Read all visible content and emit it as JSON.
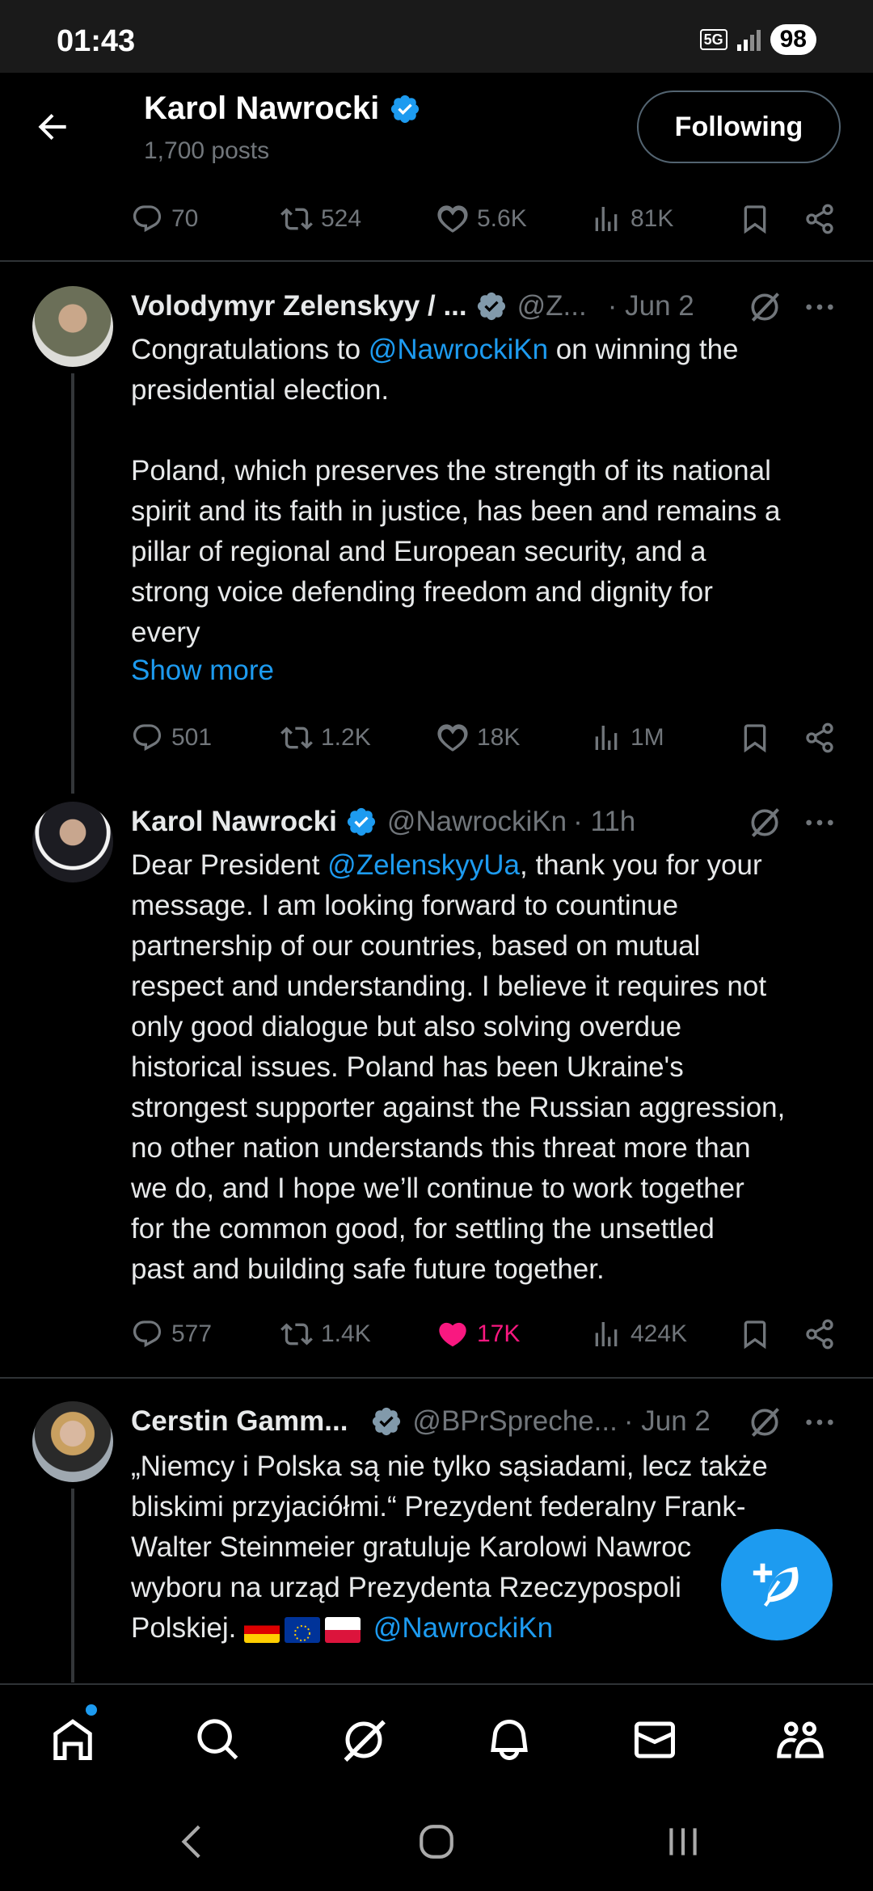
{
  "status_bar": {
    "time": "01:43",
    "network": "5G",
    "battery": "98"
  },
  "header": {
    "name": "Karol Nawrocki",
    "posts": "1,700 posts",
    "follow_label": "Following"
  },
  "top_actions": {
    "replies": "70",
    "retweets": "524",
    "likes": "5.6K",
    "views": "81K"
  },
  "tweets": [
    {
      "name": "Volodymyr Zelenskyy / ...",
      "handle": "@Z...",
      "time": "· Jun 2",
      "text_pre": "Congratulations to ",
      "mention": "@NawrockiKn",
      "text_post": " on winning the\npresidential election.\n\nPoland, which preserves the strength of its national\nspirit and its faith in justice, has been and remains a\npillar of regional and European security, and a\nstrong voice defending freedom and dignity for\nevery",
      "show_more": "Show more",
      "replies": "501",
      "retweets": "1.2K",
      "likes": "18K",
      "views": "1M"
    },
    {
      "name": "Karol Nawrocki",
      "handle": "@NawrockiKn",
      "time": "· 11h",
      "text_pre": "Dear President ",
      "mention": "@ZelenskyyUa",
      "text_post": ", thank you for your\nmessage. I am looking forward to countinue\npartnership of our countries, based on mutual\nrespect and understanding. I believe it requires not\nonly good dialogue but also solving overdue\nhistorical issues. Poland has been Ukraine's\nstrongest supporter against the Russian aggression,\nno other nation understands this threat more than\nwe do, and I hope we’ll continue to work together\nfor the common good, for settling the unsettled\npast and building safe future together.",
      "replies": "577",
      "retweets": "1.4K",
      "likes": "17K",
      "views": "424K"
    },
    {
      "name": "Cerstin Gamm...",
      "handle": "@BPrSpreche...",
      "time": "· Jun 2",
      "text": "„Niemcy i Polska są nie tylko sąsiadami, lecz także\nbliskimi przyjaciółmi.“ Prezydent federalny Frank-\nWalter Steinmeier gratuluje Karolowi Nawroc",
      "text_line4": "wyboru na urząd Prezydenta Rzeczypospoli",
      "text_line5": "Polskiej. ",
      "mention": "@NawrockiKn"
    }
  ],
  "colors": {
    "accent": "#1d9bf0",
    "like": "#f91880",
    "muted": "#71767b",
    "divider": "#2f3336"
  },
  "icons": [
    "back-arrow-icon",
    "verified-badge-icon",
    "reply-icon",
    "retweet-icon",
    "like-icon",
    "views-icon",
    "bookmark-icon",
    "share-icon",
    "grok-icon",
    "more-icon",
    "compose-icon",
    "home-icon",
    "search-icon",
    "grok-nav-icon",
    "notifications-icon",
    "messages-icon",
    "communities-icon"
  ]
}
